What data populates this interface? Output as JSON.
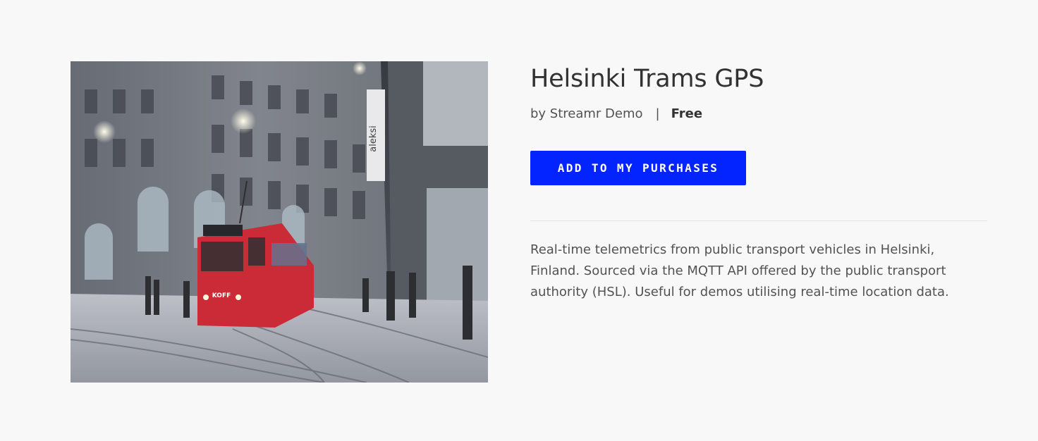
{
  "product": {
    "title": "Helsinki Trams GPS",
    "author": "by Streamr Demo",
    "separator": "|",
    "price": "Free",
    "buy_button_label": "ADD TO MY PURCHASES",
    "description": "Real-time telemetrics from public transport vehicles in Helsinki, Finland. Sourced via the MQTT API offered by the public transport authority (HSL). Useful for demos utilising real-time location data.",
    "image_signage": {
      "vertical_sign": "aleksi",
      "tram_board": "KOFF"
    }
  },
  "colors": {
    "background": "#f8f8f8",
    "accent": "#0324ff",
    "tram_red": "#c81e2a"
  }
}
